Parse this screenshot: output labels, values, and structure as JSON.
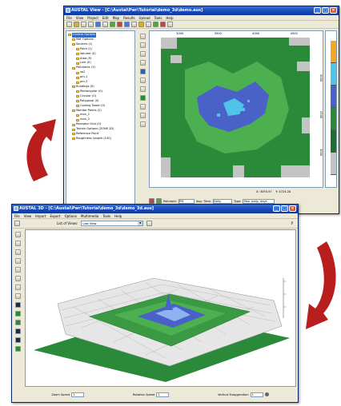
{
  "win2d": {
    "title": "AUSTAL View - [C:\\Austal\\Pwr\\Tutorial\\demo_3d\\demo.aus]",
    "menu": [
      "File",
      "View",
      "Project",
      "Edit",
      "Map",
      "Results",
      "Upload",
      "Tools",
      "Help"
    ],
    "tree": [
      {
        "label": "Control Options",
        "level": 0,
        "selected": true
      },
      {
        "label": "Met Options",
        "level": 1
      },
      {
        "label": "Sources (1)",
        "level": 1
      },
      {
        "label": "Point (1)",
        "level": 2
      },
      {
        "label": "Volume (0)",
        "level": 2
      },
      {
        "label": "Area (0)",
        "level": 2
      },
      {
        "label": "Line (0)",
        "level": 2
      },
      {
        "label": "Pollutants (3)",
        "level": 1
      },
      {
        "label": "so2",
        "level": 2
      },
      {
        "label": "pm-1",
        "level": 2
      },
      {
        "label": "pm-2",
        "level": 2
      },
      {
        "label": "Buildings (0)",
        "level": 1
      },
      {
        "label": "Rectangular (0)",
        "level": 2
      },
      {
        "label": "Circular (0)",
        "level": 2
      },
      {
        "label": "Polygonal (0)",
        "level": 2
      },
      {
        "label": "Cooling Tower (0)",
        "level": 2
      },
      {
        "label": "Monitor Points (2)",
        "level": 1
      },
      {
        "label": "mon_1",
        "level": 2
      },
      {
        "label": "mon_2",
        "level": 2
      },
      {
        "label": "Receptor Grid (0)",
        "level": 1
      },
      {
        "label": "Terrain Options (ZONE 2D)",
        "level": 1
      },
      {
        "label": "Reference Point",
        "level": 1
      },
      {
        "label": "Roughness Length (100)",
        "level": 1
      }
    ],
    "axis_top": [
      "3000",
      "3500",
      "4000",
      "4500"
    ],
    "axis_right": [
      "2000",
      "2500",
      "3000"
    ],
    "status": {
      "x": "X: 3093.97",
      "y": "Y: 4724.28"
    },
    "pollutant_label": "Pollutant:",
    "pollutant_value": "PM",
    "avg_label": "Avg. Time:",
    "avg_value": "Daily",
    "type_label": "Type:",
    "type_value": "Max. daily, days"
  },
  "win3d": {
    "title": "AUSTAL 3D - [C:\\Austal\\Pwr\\Tutorial\\demo_3d\\demo_3d.aus]",
    "menu": [
      "File",
      "View",
      "Import",
      "Export",
      "Options",
      "Multimedia",
      "Tools",
      "Help"
    ],
    "views_label": "List of Views:",
    "views_value": "Last View",
    "help_icon": "?",
    "zoom_label": "Zoom Speed",
    "zoom_value": "1",
    "rotation_label": "Rotation Speed",
    "rotation_value": "1",
    "vert_label": "Vertical Exaggeration",
    "vert_value": "1"
  },
  "colors": {
    "map_grey": "#c4c4c4",
    "map_green_dark": "#2a8a3a",
    "map_green": "#4caf50",
    "map_blue": "#4a62c8",
    "map_cyan": "#4fc3e8",
    "legend": [
      "#f5a623",
      "#4fc3e8",
      "#4a62c8",
      "#2a8a3a",
      "#1f6e2c",
      "#c4c4c4"
    ],
    "arrow": "#b81e1e"
  }
}
